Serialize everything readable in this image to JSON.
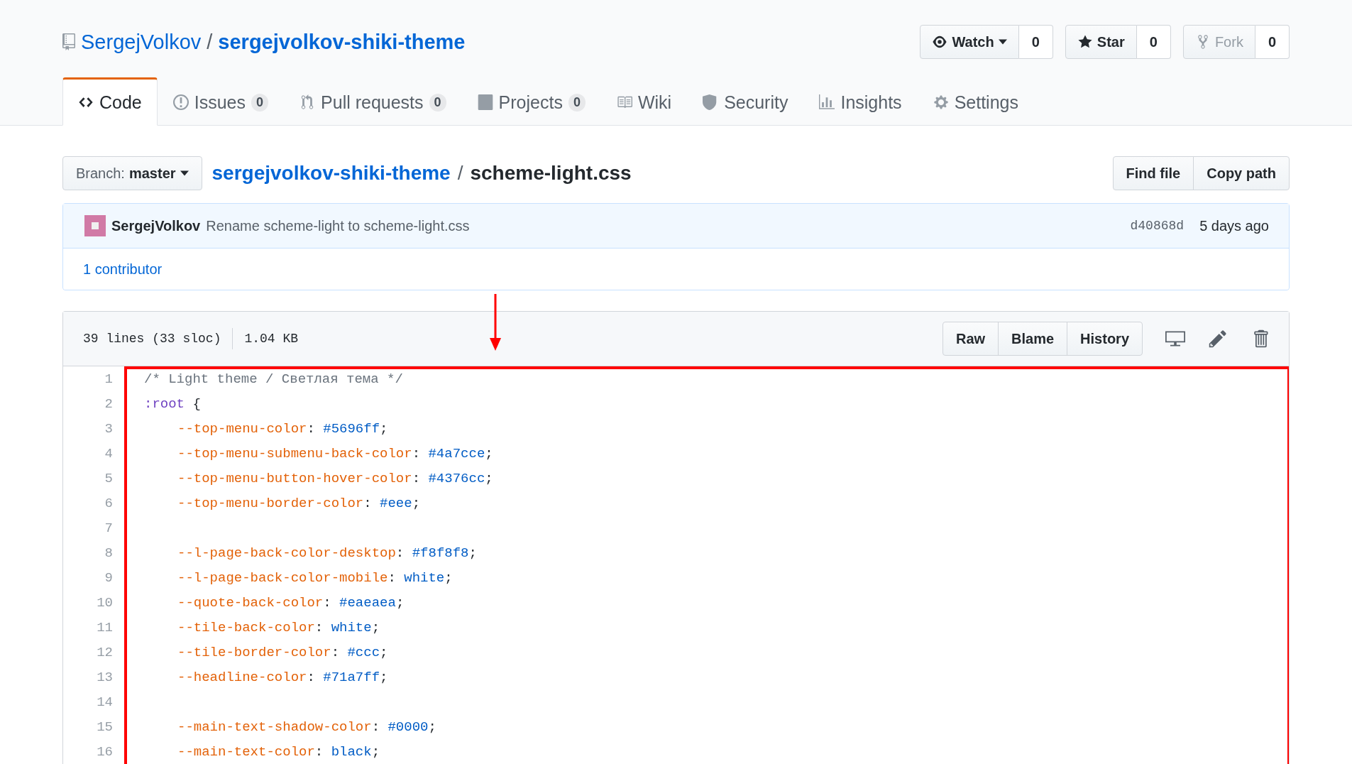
{
  "repo": {
    "owner": "SergejVolkov",
    "separator": "/",
    "name": "sergejvolkov-shiki-theme"
  },
  "social": [
    {
      "kind": "watch",
      "label": "Watch",
      "count": "0",
      "disabled": false
    },
    {
      "kind": "star",
      "label": "Star",
      "count": "0",
      "disabled": false
    },
    {
      "kind": "fork",
      "label": "Fork",
      "count": "0",
      "disabled": true
    }
  ],
  "tabs": [
    {
      "kind": "code",
      "label": "Code",
      "selected": true
    },
    {
      "kind": "issues",
      "label": "Issues",
      "count": "0",
      "selected": false
    },
    {
      "kind": "pulls",
      "label": "Pull requests",
      "count": "0",
      "selected": false
    },
    {
      "kind": "projects",
      "label": "Projects",
      "count": "0",
      "selected": false
    },
    {
      "kind": "wiki",
      "label": "Wiki",
      "selected": false
    },
    {
      "kind": "security",
      "label": "Security",
      "selected": false
    },
    {
      "kind": "insights",
      "label": "Insights",
      "selected": false
    },
    {
      "kind": "settings",
      "label": "Settings",
      "selected": false
    }
  ],
  "branch": {
    "label": "Branch:",
    "value": "master"
  },
  "breadcrumb": {
    "repo": "sergejvolkov-shiki-theme",
    "separator": "/",
    "file": "scheme-light.css"
  },
  "file_actions": [
    "Find file",
    "Copy path"
  ],
  "commit": {
    "author": "SergejVolkov",
    "message": "Rename scheme-light to scheme-light.css",
    "sha": "d40868d",
    "time": "5 days ago"
  },
  "contributors": {
    "count": "1",
    "label": "contributor"
  },
  "file_info": {
    "lines": "39 lines (33 sloc)",
    "size": "1.04 KB"
  },
  "view_buttons": [
    "Raw",
    "Blame",
    "History"
  ],
  "code": [
    {
      "number": "1",
      "indented": false,
      "tokens": [
        {
          "kind": "comment",
          "text": "/* Light theme / Светлая тема */"
        }
      ]
    },
    {
      "number": "2",
      "indented": false,
      "tokens": [
        {
          "kind": "selector",
          "text": ":root"
        },
        {
          "kind": "punct",
          "text": " {"
        }
      ]
    },
    {
      "number": "3",
      "indented": true,
      "tokens": [
        {
          "kind": "property",
          "text": "--top-menu-color"
        },
        {
          "kind": "punct",
          "text": ": "
        },
        {
          "kind": "value",
          "text": "#5696ff"
        },
        {
          "kind": "punct",
          "text": ";"
        }
      ]
    },
    {
      "number": "4",
      "indented": true,
      "tokens": [
        {
          "kind": "property",
          "text": "--top-menu-submenu-back-color"
        },
        {
          "kind": "punct",
          "text": ": "
        },
        {
          "kind": "value",
          "text": "#4a7cce"
        },
        {
          "kind": "punct",
          "text": ";"
        }
      ]
    },
    {
      "number": "5",
      "indented": true,
      "tokens": [
        {
          "kind": "property",
          "text": "--top-menu-button-hover-color"
        },
        {
          "kind": "punct",
          "text": ": "
        },
        {
          "kind": "value",
          "text": "#4376cc"
        },
        {
          "kind": "punct",
          "text": ";"
        }
      ]
    },
    {
      "number": "6",
      "indented": true,
      "tokens": [
        {
          "kind": "property",
          "text": "--top-menu-border-color"
        },
        {
          "kind": "punct",
          "text": ": "
        },
        {
          "kind": "value",
          "text": "#eee"
        },
        {
          "kind": "punct",
          "text": ";"
        }
      ]
    },
    {
      "number": "7"
    },
    {
      "number": "8",
      "indented": true,
      "tokens": [
        {
          "kind": "property",
          "text": "--l-page-back-color-desktop"
        },
        {
          "kind": "punct",
          "text": ": "
        },
        {
          "kind": "value",
          "text": "#f8f8f8"
        },
        {
          "kind": "punct",
          "text": ";"
        }
      ]
    },
    {
      "number": "9",
      "indented": true,
      "tokens": [
        {
          "kind": "property",
          "text": "--l-page-back-color-mobile"
        },
        {
          "kind": "punct",
          "text": ": "
        },
        {
          "kind": "value",
          "text": "white"
        },
        {
          "kind": "punct",
          "text": ";"
        }
      ]
    },
    {
      "number": "10",
      "indented": true,
      "tokens": [
        {
          "kind": "property",
          "text": "--quote-back-color"
        },
        {
          "kind": "punct",
          "text": ": "
        },
        {
          "kind": "value",
          "text": "#eaeaea"
        },
        {
          "kind": "punct",
          "text": ";"
        }
      ]
    },
    {
      "number": "11",
      "indented": true,
      "tokens": [
        {
          "kind": "property",
          "text": "--tile-back-color"
        },
        {
          "kind": "punct",
          "text": ": "
        },
        {
          "kind": "value",
          "text": "white"
        },
        {
          "kind": "punct",
          "text": ";"
        }
      ]
    },
    {
      "number": "12",
      "indented": true,
      "tokens": [
        {
          "kind": "property",
          "text": "--tile-border-color"
        },
        {
          "kind": "punct",
          "text": ": "
        },
        {
          "kind": "value",
          "text": "#ccc"
        },
        {
          "kind": "punct",
          "text": ";"
        }
      ]
    },
    {
      "number": "13",
      "indented": true,
      "tokens": [
        {
          "kind": "property",
          "text": "--headline-color"
        },
        {
          "kind": "punct",
          "text": ": "
        },
        {
          "kind": "value",
          "text": "#71a7ff"
        },
        {
          "kind": "punct",
          "text": ";"
        }
      ]
    },
    {
      "number": "14"
    },
    {
      "number": "15",
      "indented": true,
      "tokens": [
        {
          "kind": "property",
          "text": "--main-text-shadow-color"
        },
        {
          "kind": "punct",
          "text": ": "
        },
        {
          "kind": "value",
          "text": "#0000"
        },
        {
          "kind": "punct",
          "text": ";"
        }
      ]
    },
    {
      "number": "16",
      "indented": true,
      "tokens": [
        {
          "kind": "property",
          "text": "--main-text-color"
        },
        {
          "kind": "punct",
          "text": ": "
        },
        {
          "kind": "value",
          "text": "black"
        },
        {
          "kind": "punct",
          "text": ";"
        }
      ]
    }
  ]
}
